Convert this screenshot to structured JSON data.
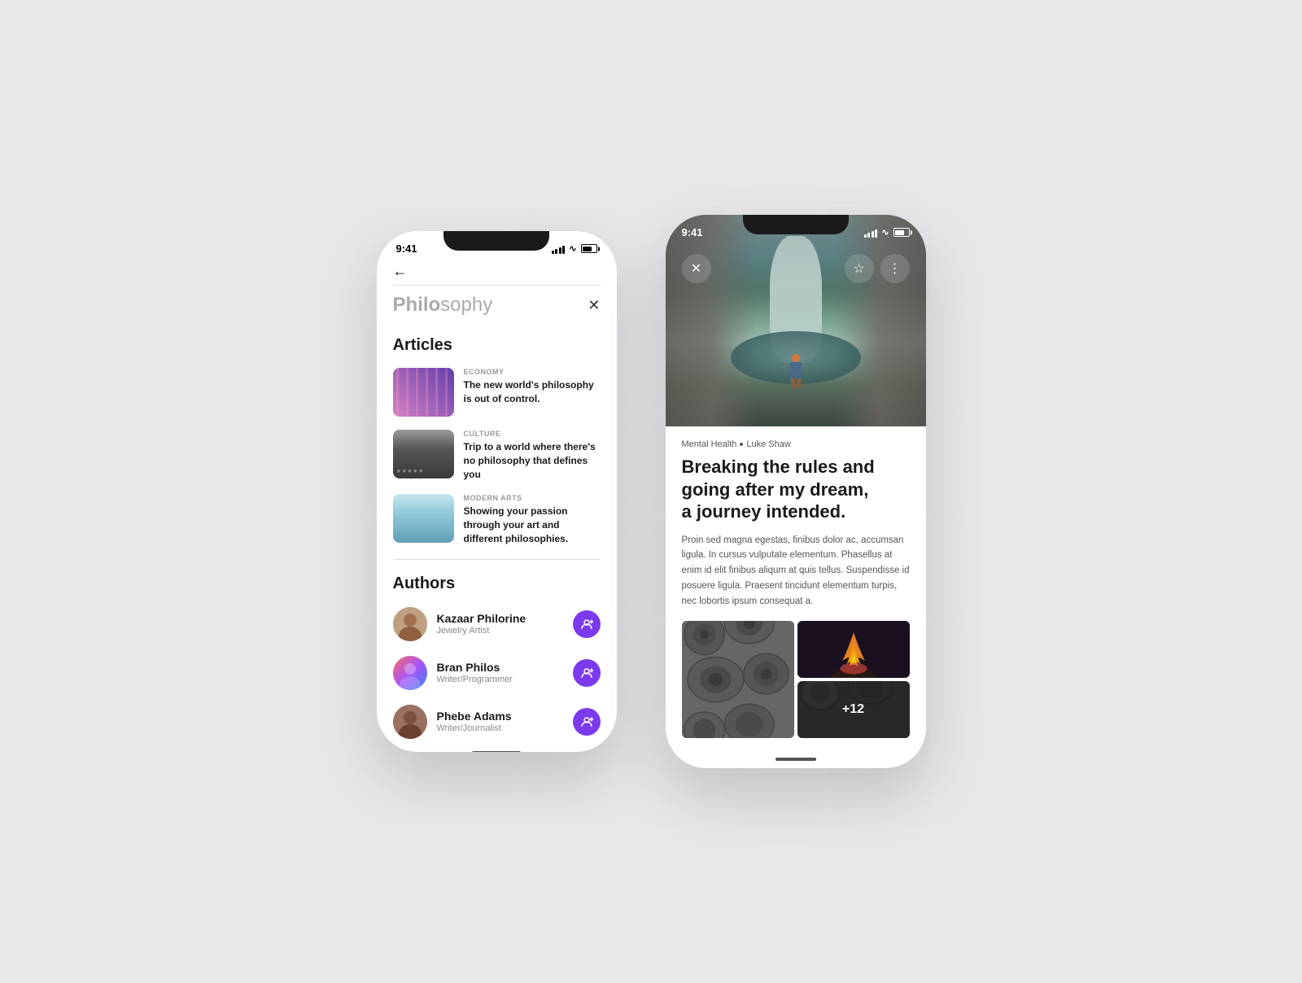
{
  "page": {
    "background": "#e8e8eb"
  },
  "phone1": {
    "status": {
      "time": "9:41"
    },
    "search_title_bold": "Philo",
    "search_title_light": "sophy",
    "sections": {
      "articles": {
        "label": "Articles",
        "items": [
          {
            "category": "ECONOMY",
            "headline": "The new world's philosophy is out of control.",
            "thumb_type": "economy"
          },
          {
            "category": "CULTURE",
            "headline": "Trip to a world where there's no philosophy that defines you",
            "thumb_type": "culture"
          },
          {
            "category": "MODERN ARTS",
            "headline": "Showing your passion through your art and different philosophies.",
            "thumb_type": "arts"
          }
        ]
      },
      "authors": {
        "label": "Authors",
        "items": [
          {
            "name": "Kazaar Philorine",
            "role": "Jewelry Artist",
            "avatar_type": "kazaar"
          },
          {
            "name": "Bran Philos",
            "role": "Writer/Programmer",
            "avatar_type": "bran"
          },
          {
            "name": "Phebe Adams",
            "role": "Writer/Journalist",
            "avatar_type": "phebe"
          }
        ]
      }
    }
  },
  "phone2": {
    "status": {
      "time": "9:41"
    },
    "article": {
      "meta_category": "Mental Health",
      "meta_dot": "•",
      "meta_author": "Luke Shaw",
      "title": "Breaking the rules and going after my dream, a journey intended.",
      "title_line1": "Breaking the rules and",
      "title_line2": "going after my dream,",
      "title_line3": "a journey intended.",
      "body": "Proin sed magna egestas, finibus dolor ac, accumsan ligula. In cursus vulputate elementum. Phasellus at enim id elit finibus aliqum at quis tellus. Suspendisse id posuere ligula. Praesent tincidunt elementum turpis, nec lobortis ipsum consequat a.",
      "photo_count_label": "+12"
    }
  }
}
